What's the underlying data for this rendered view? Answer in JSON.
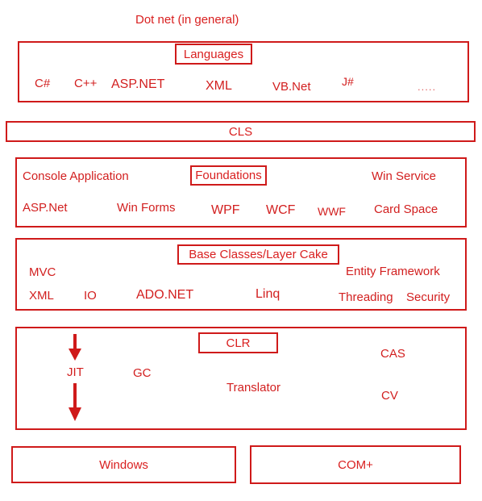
{
  "title": "Dot net (in general)",
  "colors": {
    "stroke": "#cf1a1a",
    "text": "#d92020",
    "muted": "#e06666",
    "background": "#ffffff"
  },
  "layers": {
    "languages": {
      "tag": "Languages",
      "items": [
        {
          "label": "C#"
        },
        {
          "label": "C++"
        },
        {
          "label": "ASP.NET"
        },
        {
          "label": "XML"
        },
        {
          "label": "VB.Net"
        },
        {
          "label": "J#"
        },
        {
          "label": "....."
        }
      ]
    },
    "cls": {
      "tag": "CLS"
    },
    "foundations": {
      "tag": "Foundations",
      "row1": [
        {
          "label": "Console Application"
        },
        {
          "label": "Win Service"
        }
      ],
      "row2": [
        {
          "label": "ASP.Net"
        },
        {
          "label": "Win Forms"
        },
        {
          "label": "WPF"
        },
        {
          "label": "WCF"
        },
        {
          "label": "WWF"
        },
        {
          "label": "Card Space"
        }
      ]
    },
    "base_classes": {
      "tag": "Base Classes/Layer Cake",
      "row1": [
        {
          "label": "MVC"
        },
        {
          "label": "Entity Framework"
        }
      ],
      "row2": [
        {
          "label": "XML"
        },
        {
          "label": "IO"
        },
        {
          "label": "ADO.NET"
        },
        {
          "label": "Linq"
        },
        {
          "label": "Threading"
        },
        {
          "label": "Security"
        }
      ]
    },
    "clr": {
      "tag": "CLR",
      "items": [
        {
          "label": "JIT"
        },
        {
          "label": "GC"
        },
        {
          "label": "Translator"
        },
        {
          "label": "CAS"
        },
        {
          "label": "CV"
        }
      ],
      "arrows": [
        {
          "name": "down-arrow-top"
        },
        {
          "name": "down-arrow-bottom"
        }
      ]
    },
    "platform": {
      "boxes": [
        {
          "label": "Windows"
        },
        {
          "label": "COM+"
        }
      ]
    }
  }
}
